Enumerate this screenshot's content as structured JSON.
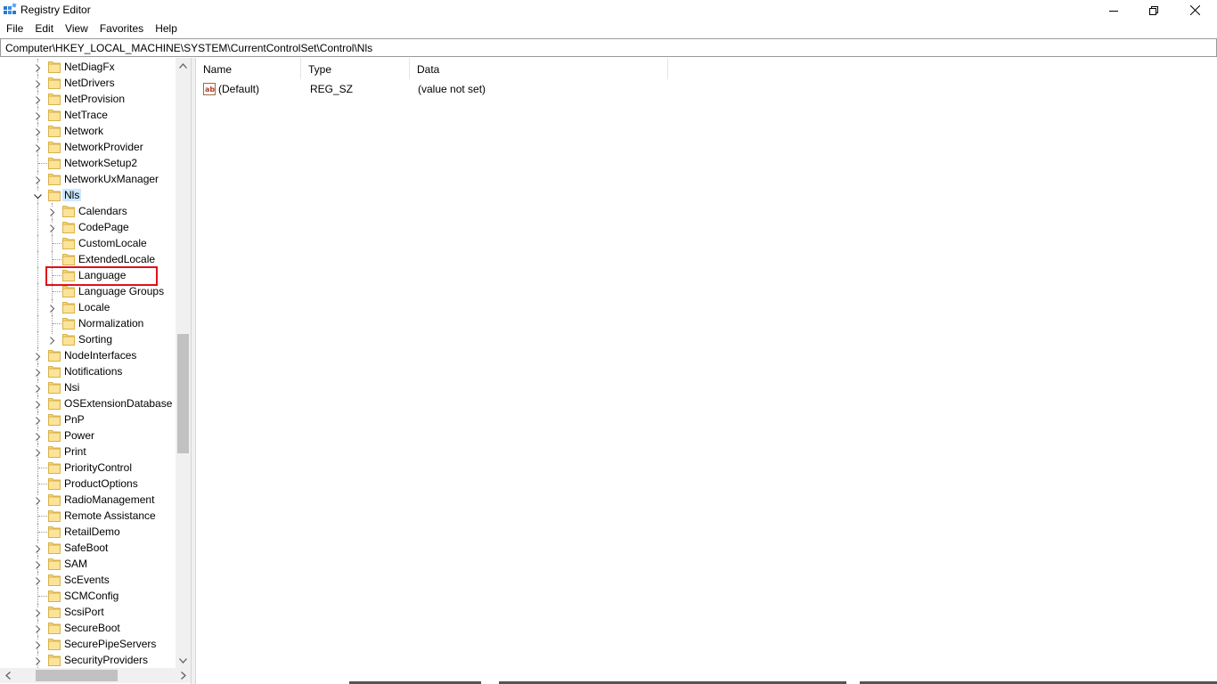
{
  "window": {
    "title": "Registry Editor"
  },
  "menu": [
    "File",
    "Edit",
    "View",
    "Favorites",
    "Help"
  ],
  "address": "Computer\\HKEY_LOCAL_MACHINE\\SYSTEM\\CurrentControlSet\\Control\\Nls",
  "tree": {
    "items": [
      {
        "label": "NetDiagFx",
        "level": 0,
        "expander": "collapsed"
      },
      {
        "label": "NetDrivers",
        "level": 0,
        "expander": "collapsed"
      },
      {
        "label": "NetProvision",
        "level": 0,
        "expander": "collapsed"
      },
      {
        "label": "NetTrace",
        "level": 0,
        "expander": "collapsed"
      },
      {
        "label": "Network",
        "level": 0,
        "expander": "collapsed"
      },
      {
        "label": "NetworkProvider",
        "level": 0,
        "expander": "collapsed"
      },
      {
        "label": "NetworkSetup2",
        "level": 0,
        "expander": "none"
      },
      {
        "label": "NetworkUxManager",
        "level": 0,
        "expander": "collapsed"
      },
      {
        "label": "Nls",
        "level": 0,
        "expander": "expanded",
        "selected": true
      },
      {
        "label": "Calendars",
        "level": 1,
        "expander": "collapsed"
      },
      {
        "label": "CodePage",
        "level": 1,
        "expander": "collapsed"
      },
      {
        "label": "CustomLocale",
        "level": 1,
        "expander": "none"
      },
      {
        "label": "ExtendedLocale",
        "level": 1,
        "expander": "none"
      },
      {
        "label": "Language",
        "level": 1,
        "expander": "none",
        "highlighted": true
      },
      {
        "label": "Language Groups",
        "level": 1,
        "expander": "none"
      },
      {
        "label": "Locale",
        "level": 1,
        "expander": "collapsed"
      },
      {
        "label": "Normalization",
        "level": 1,
        "expander": "none"
      },
      {
        "label": "Sorting",
        "level": 1,
        "expander": "collapsed"
      },
      {
        "label": "NodeInterfaces",
        "level": 0,
        "expander": "collapsed"
      },
      {
        "label": "Notifications",
        "level": 0,
        "expander": "collapsed"
      },
      {
        "label": "Nsi",
        "level": 0,
        "expander": "collapsed"
      },
      {
        "label": "OSExtensionDatabase",
        "level": 0,
        "expander": "collapsed"
      },
      {
        "label": "PnP",
        "level": 0,
        "expander": "collapsed"
      },
      {
        "label": "Power",
        "level": 0,
        "expander": "collapsed"
      },
      {
        "label": "Print",
        "level": 0,
        "expander": "collapsed"
      },
      {
        "label": "PriorityControl",
        "level": 0,
        "expander": "none"
      },
      {
        "label": "ProductOptions",
        "level": 0,
        "expander": "none"
      },
      {
        "label": "RadioManagement",
        "level": 0,
        "expander": "collapsed"
      },
      {
        "label": "Remote Assistance",
        "level": 0,
        "expander": "none"
      },
      {
        "label": "RetailDemo",
        "level": 0,
        "expander": "none"
      },
      {
        "label": "SafeBoot",
        "level": 0,
        "expander": "collapsed"
      },
      {
        "label": "SAM",
        "level": 0,
        "expander": "collapsed"
      },
      {
        "label": "ScEvents",
        "level": 0,
        "expander": "collapsed"
      },
      {
        "label": "SCMConfig",
        "level": 0,
        "expander": "none"
      },
      {
        "label": "ScsiPort",
        "level": 0,
        "expander": "collapsed"
      },
      {
        "label": "SecureBoot",
        "level": 0,
        "expander": "collapsed"
      },
      {
        "label": "SecurePipeServers",
        "level": 0,
        "expander": "collapsed"
      },
      {
        "label": "SecurityProviders",
        "level": 0,
        "expander": "collapsed"
      }
    ]
  },
  "values_pane": {
    "columns": [
      "Name",
      "Type",
      "Data"
    ],
    "rows": [
      {
        "icon": "string-value-icon",
        "name": "(Default)",
        "type": "REG_SZ",
        "data": "(value not set)"
      }
    ]
  },
  "colors": {
    "selection": "#cce8ff",
    "highlight_box": "#e0101a",
    "folder": "#f8d775"
  }
}
